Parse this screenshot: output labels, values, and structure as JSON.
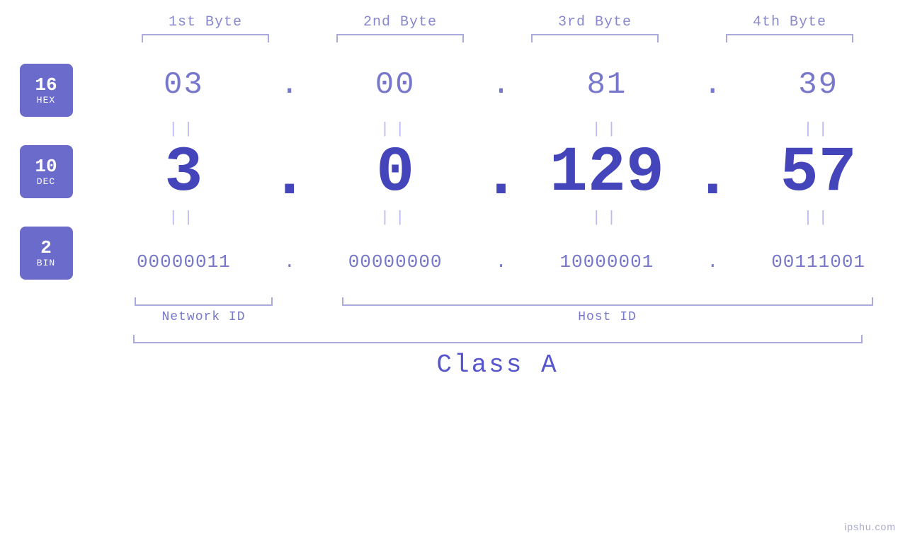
{
  "header": {
    "byte1_label": "1st Byte",
    "byte2_label": "2nd Byte",
    "byte3_label": "3rd Byte",
    "byte4_label": "4th Byte"
  },
  "badges": {
    "hex": {
      "number": "16",
      "label": "HEX"
    },
    "dec": {
      "number": "10",
      "label": "DEC"
    },
    "bin": {
      "number": "2",
      "label": "BIN"
    }
  },
  "hex_row": {
    "b1": "03",
    "b2": "00",
    "b3": "81",
    "b4": "39",
    "dot": "."
  },
  "dec_row": {
    "b1": "3",
    "b2": "0",
    "b3": "129",
    "b4": "57",
    "dot": "."
  },
  "bin_row": {
    "b1": "00000011",
    "b2": "00000000",
    "b3": "10000001",
    "b4": "00111001",
    "dot": "."
  },
  "labels": {
    "network_id": "Network ID",
    "host_id": "Host ID",
    "class": "Class A"
  },
  "watermark": "ipshu.com"
}
